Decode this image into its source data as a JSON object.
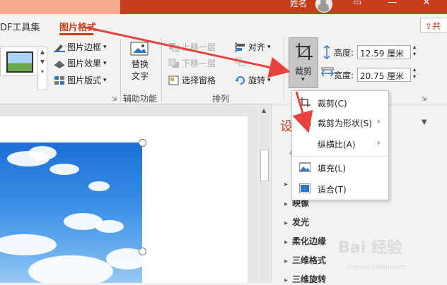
{
  "titlebar": {
    "user_name": "姓名",
    "minimize": "▭",
    "close": "✕"
  },
  "tabs": [
    {
      "label": "DF工具集"
    },
    {
      "label": "图片格式"
    }
  ],
  "share": {
    "label": "共"
  },
  "ribbon": {
    "styles": {
      "border": "图片边框",
      "effects": "图片效果",
      "layout": "图片版式"
    },
    "accessibility": {
      "alt_text_line1": "替换",
      "alt_text_line2": "文字",
      "group": "辅助功能"
    },
    "arrange": {
      "bring_forward": "上移一层",
      "send_backward": "下移一层",
      "selection_pane": "选择窗格",
      "align": "对齐",
      "rotate": "旋转",
      "group": "排列"
    },
    "size": {
      "crop": "裁剪",
      "height_label": "高度:",
      "height_value": "12.59 厘米",
      "width_label": "宽度:",
      "width_value": "20.75 厘米"
    }
  },
  "crop_menu": {
    "items": [
      {
        "label": "裁剪(C)",
        "icon": "crop-icon"
      },
      {
        "label": "裁剪为形状(S)",
        "icon": "shape-crop-icon",
        "submenu": true
      },
      {
        "label": "纵横比(A)",
        "icon": "",
        "submenu": true
      },
      {
        "label": "填充(L)",
        "icon": "fill-icon"
      },
      {
        "label": "适合(T)",
        "icon": "fit-icon"
      }
    ]
  },
  "format_pane": {
    "title": "设",
    "items": [
      "阴影",
      "映像",
      "发光",
      "柔化边缘",
      "三维格式",
      "三维旋转"
    ]
  },
  "watermark": {
    "main": "Bai 经验",
    "sub": "jingyan.baidu.com"
  },
  "colors": {
    "accent": "#c43e1c",
    "arrow": "#e8423c"
  }
}
